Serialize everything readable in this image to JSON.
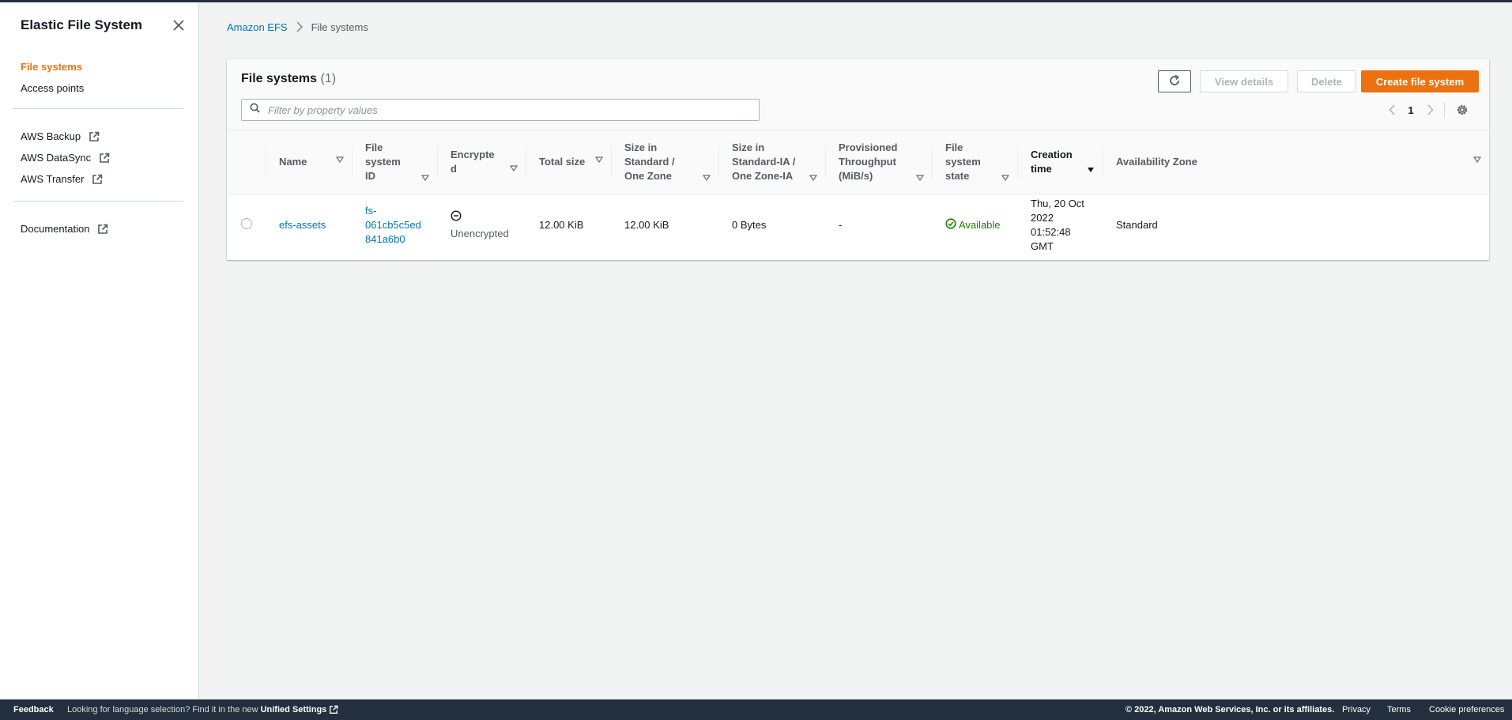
{
  "sidebar": {
    "title": "Elastic File System",
    "nav": [
      {
        "label": "File systems",
        "active": true
      },
      {
        "label": "Access points",
        "active": false
      }
    ],
    "external_links": [
      {
        "label": "AWS Backup"
      },
      {
        "label": "AWS DataSync"
      },
      {
        "label": "AWS Transfer"
      }
    ],
    "documentation": "Documentation"
  },
  "breadcrumb": {
    "root": "Amazon EFS",
    "current": "File systems"
  },
  "panel": {
    "title": "File systems",
    "count": "(1)",
    "buttons": {
      "view_details": "View details",
      "delete": "Delete",
      "create": "Create file system"
    },
    "search_placeholder": "Filter by property values",
    "page": "1"
  },
  "table": {
    "headers": {
      "name": "Name",
      "fsid_1": "File",
      "fsid_2": "system",
      "fsid_3": "ID",
      "enc_1": "Encrypte",
      "enc_2": "d",
      "total": "Total size",
      "std_1": "Size in",
      "std_2": "Standard /",
      "std_3": "One Zone",
      "ia_1": "Size in",
      "ia_2": "Standard-IA /",
      "ia_3": "One Zone-IA",
      "prov_1": "Provisioned",
      "prov_2": "Throughput",
      "prov_3": "(MiB/s)",
      "state_1": "File",
      "state_2": "system",
      "state_3": "state",
      "created_1": "Creation",
      "created_2": "time",
      "az": "Availability Zone"
    },
    "rows": [
      {
        "name": "efs-assets",
        "fsid_1": "fs-",
        "fsid_2": "061cb5c5ed",
        "fsid_3": "841a6b0",
        "encrypted": "Unencrypted",
        "total": "12.00 KiB",
        "std": "12.00 KiB",
        "ia": "0 Bytes",
        "prov": "-",
        "state": "Available",
        "created_1": "Thu, 20 Oct",
        "created_2": "2022",
        "created_3": "01:52:48",
        "created_4": "GMT",
        "az": "Standard"
      }
    ]
  },
  "footer": {
    "feedback": "Feedback",
    "lang_text": "Looking for language selection? Find it in the new",
    "lang_link": "Unified Settings",
    "copyright": "© 2022, Amazon Web Services, Inc. or its affiliates.",
    "privacy": "Privacy",
    "terms": "Terms",
    "cookies": "Cookie preferences"
  },
  "colors": {
    "accent": "#ec7211",
    "link": "#0073bb",
    "success": "#1d8102",
    "footer_bg": "#232f3e"
  },
  "icons": [
    "close-icon",
    "external-link-icon",
    "chevron-right-icon",
    "refresh-icon",
    "search-icon",
    "chevron-left-icon",
    "gear-icon",
    "sort-icon",
    "minus-circle-icon",
    "check-circle-icon"
  ]
}
